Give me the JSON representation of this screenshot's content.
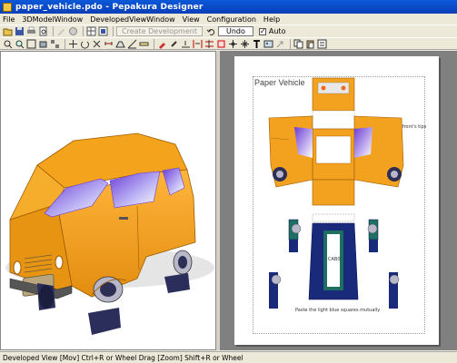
{
  "window": {
    "title": "paper_vehicle.pdo - Pepakura Designer"
  },
  "menu": [
    "File",
    "3DModelWindow",
    "DevelopedViewWindow",
    "View",
    "Configuration",
    "Help"
  ],
  "toolbar": {
    "create_dev_label": "Create Development",
    "undo_label": "Undo",
    "auto_label": "Auto",
    "auto_checked": true
  },
  "sheet": {
    "title": "Paper Vehicle",
    "note_top": "Paste roof with front's tips",
    "note_bottom": "Paste the light blue squares mutually",
    "bottom_label": "CAB0"
  },
  "status": {
    "text": "Developed View [Mov] Ctrl+R or Wheel Drag [Zoom] Shift+R or Wheel"
  },
  "colors": {
    "car_body": "#f2a21e",
    "car_outline": "#9b5a00",
    "navy": "#1a2a7a",
    "teal": "#1e6f62"
  },
  "icons": {
    "toolbar_row1": [
      "open-icon",
      "save-icon",
      "print-icon",
      "preview-icon",
      "fold-icon",
      "edit-icon",
      "pencil-icon",
      "sphere-icon",
      "grid-icon",
      "texture-icon"
    ],
    "toolbar_row2": [
      "zoom-in-icon",
      "zoom-icon",
      "select-icon",
      "box-icon",
      "pattern-icon",
      "move-icon",
      "rotate-icon",
      "cut-icon",
      "join-icon",
      "flap-icon",
      "angle-icon",
      "measure-icon",
      "paint-icon",
      "brush-icon",
      "line-icon",
      "split-icon",
      "stitch-icon",
      "edge-icon",
      "join-edge-icon",
      "center-icon",
      "text-icon",
      "image-icon",
      "arrow-icon",
      "copy-icon",
      "paste-icon",
      "settings-icon"
    ]
  }
}
